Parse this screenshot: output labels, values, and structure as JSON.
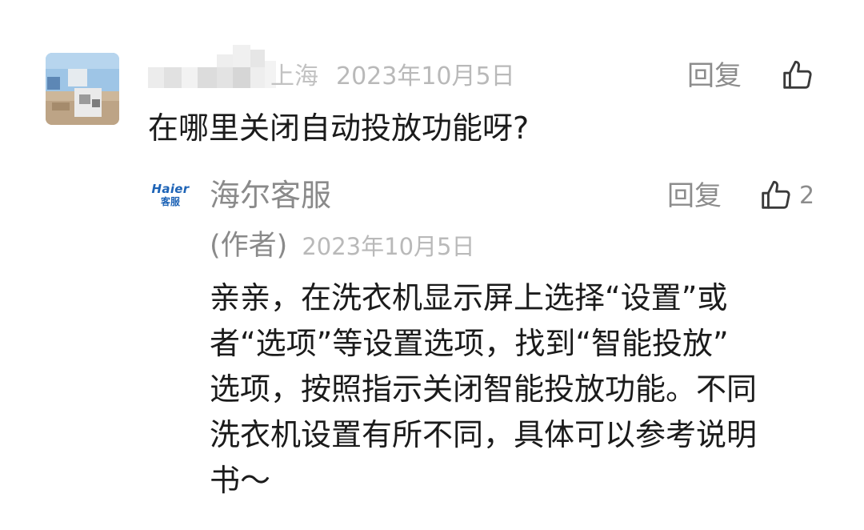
{
  "comment": {
    "location": "上海",
    "date": "2023年10月5日",
    "reply_label": "回复",
    "text": "在哪里关闭自动投放功能呀?"
  },
  "reply": {
    "logo": {
      "line1": "Haier",
      "line2": "客服"
    },
    "author": "海尔客服",
    "author_tag": "(作者)",
    "date": "2023年10月5日",
    "reply_label": "回复",
    "like_count": "2",
    "body_lines": [
      "亲亲，在洗衣机显示屏上选择“设置”或",
      "者“选项”等设置选项，找到“智能投放”",
      "选项，按照指示关闭智能投放功能。不同",
      "洗衣机设置有所不同，具体可以参考说明",
      "书～"
    ]
  },
  "colors": {
    "text": "#1b1b1b",
    "muted": "#8c8c8c",
    "meta": "#b9b9b9",
    "brand": "#1d63b6"
  }
}
